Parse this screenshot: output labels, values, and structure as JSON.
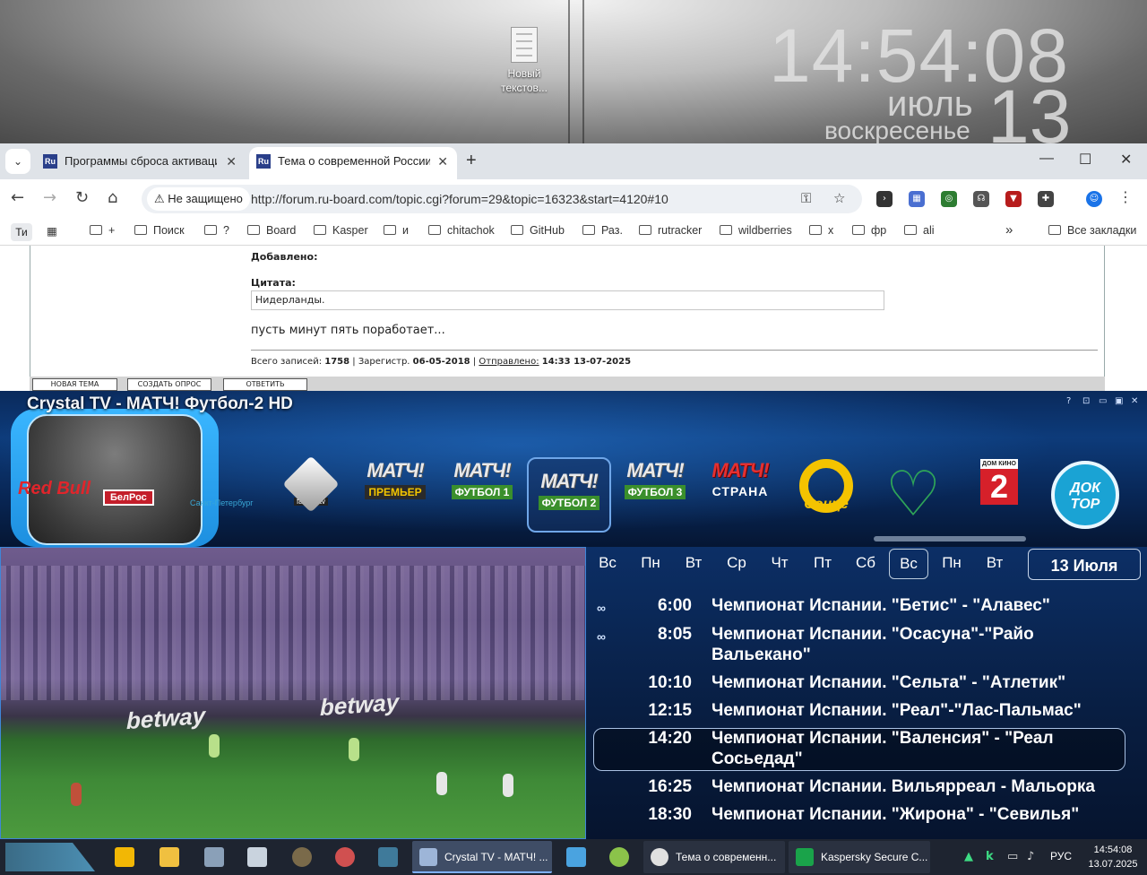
{
  "desktop": {
    "icon_label": "Новый текстов...",
    "clock_time": "14:54:08",
    "clock_month": "июль",
    "clock_day": "13",
    "clock_weekday": "воскресенье"
  },
  "browser": {
    "tabs": [
      {
        "favicon": "Ru",
        "title": "Программы сброса активации",
        "close": "✕"
      },
      {
        "favicon": "Ru",
        "title": "Тема о современной России -",
        "close": "✕"
      }
    ],
    "new_tab": "+",
    "window_controls": {
      "minimize": "—",
      "maximize": "☐",
      "close": "✕"
    },
    "security_label": "Не защищено",
    "url": "http://forum.ru-board.com/topic.cgi?forum=29&topic=16323&start=4120#10",
    "bookmarks": {
      "first": "Ти",
      "items": [
        "+",
        "Поиск",
        "?",
        "Board",
        "Kasper",
        "и",
        "chitachok",
        "GitHub",
        "Раз.",
        "rutracker",
        "wildberries",
        "x",
        "фр",
        "ali"
      ],
      "more": "»",
      "all": "Все закладки"
    }
  },
  "forum": {
    "added_label": "Добавлено:",
    "quote_label": "Цитата:",
    "quote_text": "Нидерланды.",
    "message": "пусть минут пять поработает...",
    "footer": {
      "posts_label": "Всего записей:",
      "posts_count": "1758",
      "registered_label": "| Зарегистр.",
      "registered_date": "06-05-2018",
      "sent_label": "Отправлено:",
      "sent_value": "14:33 13-07-2025"
    },
    "buttons": {
      "new_topic": "НОВАЯ ТЕМА",
      "new_poll": "СОЗДАТЬ ОПРОС",
      "reply": "ОТВЕТИТЬ"
    }
  },
  "tv": {
    "title": "Crystal TV - МАТЧ! Футбол-2 HD",
    "controls": [
      "?",
      "⊡",
      "▭",
      "▣",
      "✕"
    ],
    "sponsor_logos": [
      "Red Bull",
      "БелРос",
      "Санкт-Петербург"
    ],
    "channels": [
      {
        "name": "fashiontv",
        "label": "f"
      },
      {
        "name": "МАТЧ!",
        "sub": "ПРЕМЬЕР"
      },
      {
        "name": "МАТЧ!",
        "sub": "ФУТБОЛ 1"
      },
      {
        "name": "МАТЧ!",
        "sub": "ФУТБОЛ 2"
      },
      {
        "name": "МАТЧ!",
        "sub": "ФУТБОЛ 3"
      },
      {
        "name": "МАТЧ!",
        "sub": "СТРАНА"
      },
      {
        "name": "Сонце",
        "label": "Сонце"
      },
      {
        "name": "heart-tree"
      },
      {
        "name": "ДОМ КИНО",
        "label": "2"
      },
      {
        "name": "ДОКТОР",
        "label": "ДОК ТОР"
      }
    ],
    "days": [
      "Вс",
      "Пн",
      "Вт",
      "Ср",
      "Чт",
      "Пт",
      "Сб",
      "Вс",
      "Пн",
      "Вт"
    ],
    "active_day_index": 7,
    "date": "13 Июля",
    "programs": [
      {
        "time": "6:00",
        "title": "Чемпионат Испании. \"Бетис\" - \"Алавес\"",
        "icon": "∞"
      },
      {
        "time": "8:05",
        "title": "Чемпионат Испании. \"Осасуна\"-\"Райо Вальекано\"",
        "icon": "∞"
      },
      {
        "time": "10:10",
        "title": "Чемпионат Испании. \"Сельта\" - \"Атлетик\""
      },
      {
        "time": "12:15",
        "title": "Чемпионат Испании. \"Реал\"-\"Лас-Пальмас\""
      },
      {
        "time": "14:20",
        "title": "Чемпионат Испании. \"Валенсия\" - \"Реал Сосьедад\"",
        "current": true
      },
      {
        "time": "16:25",
        "title": "Чемпионат Испании. Вильярреал - Мальорка"
      },
      {
        "time": "18:30",
        "title": "Чемпионат Испании. \"Жирона\" - \"Севилья\""
      }
    ],
    "video_ads": [
      "betway",
      "betway"
    ]
  },
  "taskbar": {
    "tasks": [
      {
        "label": "Crystal TV - МАТЧ! ...",
        "color": "#3f4d66"
      },
      {
        "label": "Тема о современн...",
        "color": "#2a3140"
      },
      {
        "label": "Kaspersky Secure C...",
        "color": "#2a3140"
      }
    ],
    "lang": "РУС",
    "time": "14:54:08",
    "date": "13.07.2025"
  }
}
